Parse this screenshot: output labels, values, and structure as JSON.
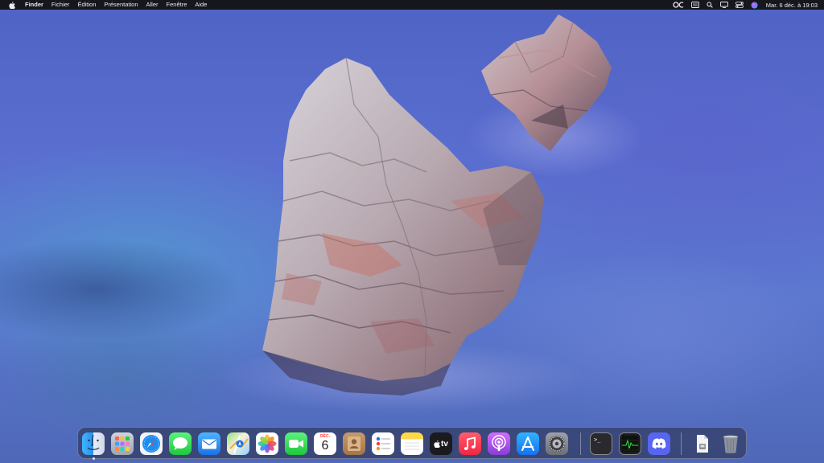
{
  "menubar": {
    "app_name": "Finder",
    "items": [
      "Fichier",
      "Édition",
      "Présentation",
      "Aller",
      "Fenêtre",
      "Aide"
    ],
    "status_icons": [
      "oc-icon",
      "keyboard-icon",
      "search-icon",
      "display-icon",
      "control-center-icon",
      "siri-icon"
    ],
    "clock": "Mar. 6 déc. à 19:03"
  },
  "dock": {
    "apps": [
      {
        "name": "Finder",
        "icon": "finder-icon"
      },
      {
        "name": "Launchpad",
        "icon": "launchpad-icon"
      },
      {
        "name": "Safari",
        "icon": "safari-icon"
      },
      {
        "name": "Messages",
        "icon": "messages-icon"
      },
      {
        "name": "Mail",
        "icon": "mail-icon"
      },
      {
        "name": "Plans",
        "icon": "maps-icon"
      },
      {
        "name": "Photos",
        "icon": "photos-icon"
      },
      {
        "name": "FaceTime",
        "icon": "facetime-icon"
      },
      {
        "name": "Calendrier",
        "icon": "calendar-icon",
        "month": "DÉC.",
        "day": "6"
      },
      {
        "name": "Contacts",
        "icon": "contacts-icon"
      },
      {
        "name": "Rappels",
        "icon": "reminders-icon"
      },
      {
        "name": "Notes",
        "icon": "notes-icon"
      },
      {
        "name": "TV",
        "icon": "apple-tv-icon",
        "label": "tv"
      },
      {
        "name": "Musique",
        "icon": "music-icon"
      },
      {
        "name": "Podcasts",
        "icon": "podcasts-icon"
      },
      {
        "name": "App Store",
        "icon": "app-store-icon"
      },
      {
        "name": "Réglages Système",
        "icon": "system-settings-icon"
      }
    ],
    "recent_apps": [
      {
        "name": "Terminal",
        "icon": "terminal-icon",
        "label": ">_"
      },
      {
        "name": "Moniteur d'activité",
        "icon": "activity-monitor-icon"
      },
      {
        "name": "Discord",
        "icon": "discord-icon"
      }
    ],
    "other": [
      {
        "name": "Document",
        "icon": "document-icon"
      },
      {
        "name": "Corbeille",
        "icon": "trash-icon"
      }
    ],
    "running_indicator_under": "Finder"
  }
}
